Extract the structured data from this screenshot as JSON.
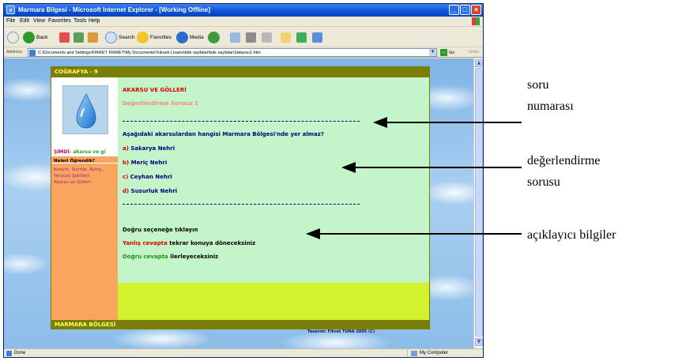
{
  "browser": {
    "title": "Marmara Bilgesi - Microsoft Internet Explorer - [Working Offline]",
    "menu": [
      "File",
      "Edit",
      "View",
      "Favorites",
      "Tools",
      "Help"
    ],
    "toolbar": {
      "back": "Back",
      "search": "Search",
      "favorites": "Favorites",
      "media": "Media"
    },
    "address_label": "Address",
    "url": "C:\\Documents and Settings\\FIKRET FIKRET\\My Documents\\Yuksek Lisans\\bde sayfalar\\bde sayfalar\\3akarsu1.htm",
    "go_label": "Go",
    "links_label": "Links",
    "status_text": "Done",
    "zone_text": "My Computer"
  },
  "page": {
    "header": "COĞRAFYA - 9",
    "now_label": "ŞİMDİ",
    "now_topic": ": akarsu ve gi",
    "learned_heading": "Neleri Öğrendik?",
    "learned_items": [
      "Konum, Sınırlar, Komş..",
      "Yeryüzü Şekilleri",
      "Akarsu ve Gölleri"
    ],
    "title": "AKARSU VE GÖLLERİ",
    "subtitle": "Değerlendirme Sorusu 1",
    "question": "Aşağıdaki akarsulardan hangisi Marmara Bölgesi'nde yer almaz?",
    "options": [
      {
        "letter": "a)",
        "text": "Sakarya Nehri"
      },
      {
        "letter": "b)",
        "text": "Meriç Nehri"
      },
      {
        "letter": "c)",
        "text": "Ceyhan Nehri"
      },
      {
        "letter": "d)",
        "text": "Susurluk Nehri"
      }
    ],
    "instruction": "Doğru seçeneğe tıklayın",
    "wrong_label": "Yanlış cevapta",
    "wrong_rest": "tekrar konuya döneceksiniz",
    "right_label": "Doğru cevapta",
    "right_rest": "ilerleyeceksiniz",
    "footer": "MARMARA BÖLGESİ",
    "credit": "Tasarım: Fikret TUNA 2005 (C)"
  },
  "annotations": {
    "number_line1": "soru",
    "number_line2": "numarası",
    "eval_line1": "değerlendirme",
    "eval_line2": "sorusu",
    "info": "açıklayıcı bilgiler"
  }
}
